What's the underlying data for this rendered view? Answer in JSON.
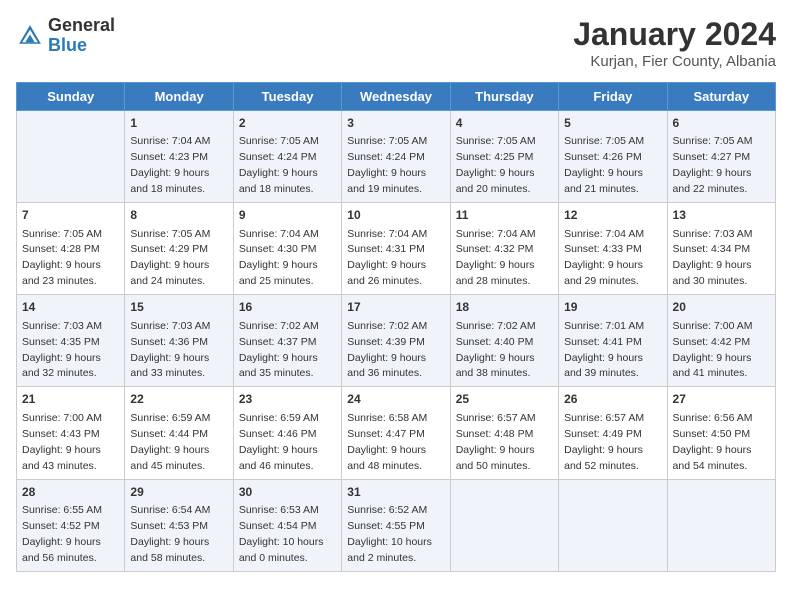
{
  "logo": {
    "general": "General",
    "blue": "Blue"
  },
  "calendar": {
    "title": "January 2024",
    "subtitle": "Kurjan, Fier County, Albania"
  },
  "headers": [
    "Sunday",
    "Monday",
    "Tuesday",
    "Wednesday",
    "Thursday",
    "Friday",
    "Saturday"
  ],
  "weeks": [
    [
      {
        "day": "",
        "sunrise": "",
        "sunset": "",
        "daylight": ""
      },
      {
        "day": "1",
        "sunrise": "7:04 AM",
        "sunset": "4:23 PM",
        "daylight": "9 hours and 18 minutes."
      },
      {
        "day": "2",
        "sunrise": "7:05 AM",
        "sunset": "4:24 PM",
        "daylight": "9 hours and 18 minutes."
      },
      {
        "day": "3",
        "sunrise": "7:05 AM",
        "sunset": "4:24 PM",
        "daylight": "9 hours and 19 minutes."
      },
      {
        "day": "4",
        "sunrise": "7:05 AM",
        "sunset": "4:25 PM",
        "daylight": "9 hours and 20 minutes."
      },
      {
        "day": "5",
        "sunrise": "7:05 AM",
        "sunset": "4:26 PM",
        "daylight": "9 hours and 21 minutes."
      },
      {
        "day": "6",
        "sunrise": "7:05 AM",
        "sunset": "4:27 PM",
        "daylight": "9 hours and 22 minutes."
      }
    ],
    [
      {
        "day": "7",
        "sunrise": "7:05 AM",
        "sunset": "4:28 PM",
        "daylight": "9 hours and 23 minutes."
      },
      {
        "day": "8",
        "sunrise": "7:05 AM",
        "sunset": "4:29 PM",
        "daylight": "9 hours and 24 minutes."
      },
      {
        "day": "9",
        "sunrise": "7:04 AM",
        "sunset": "4:30 PM",
        "daylight": "9 hours and 25 minutes."
      },
      {
        "day": "10",
        "sunrise": "7:04 AM",
        "sunset": "4:31 PM",
        "daylight": "9 hours and 26 minutes."
      },
      {
        "day": "11",
        "sunrise": "7:04 AM",
        "sunset": "4:32 PM",
        "daylight": "9 hours and 28 minutes."
      },
      {
        "day": "12",
        "sunrise": "7:04 AM",
        "sunset": "4:33 PM",
        "daylight": "9 hours and 29 minutes."
      },
      {
        "day": "13",
        "sunrise": "7:03 AM",
        "sunset": "4:34 PM",
        "daylight": "9 hours and 30 minutes."
      }
    ],
    [
      {
        "day": "14",
        "sunrise": "7:03 AM",
        "sunset": "4:35 PM",
        "daylight": "9 hours and 32 minutes."
      },
      {
        "day": "15",
        "sunrise": "7:03 AM",
        "sunset": "4:36 PM",
        "daylight": "9 hours and 33 minutes."
      },
      {
        "day": "16",
        "sunrise": "7:02 AM",
        "sunset": "4:37 PM",
        "daylight": "9 hours and 35 minutes."
      },
      {
        "day": "17",
        "sunrise": "7:02 AM",
        "sunset": "4:39 PM",
        "daylight": "9 hours and 36 minutes."
      },
      {
        "day": "18",
        "sunrise": "7:02 AM",
        "sunset": "4:40 PM",
        "daylight": "9 hours and 38 minutes."
      },
      {
        "day": "19",
        "sunrise": "7:01 AM",
        "sunset": "4:41 PM",
        "daylight": "9 hours and 39 minutes."
      },
      {
        "day": "20",
        "sunrise": "7:00 AM",
        "sunset": "4:42 PM",
        "daylight": "9 hours and 41 minutes."
      }
    ],
    [
      {
        "day": "21",
        "sunrise": "7:00 AM",
        "sunset": "4:43 PM",
        "daylight": "9 hours and 43 minutes."
      },
      {
        "day": "22",
        "sunrise": "6:59 AM",
        "sunset": "4:44 PM",
        "daylight": "9 hours and 45 minutes."
      },
      {
        "day": "23",
        "sunrise": "6:59 AM",
        "sunset": "4:46 PM",
        "daylight": "9 hours and 46 minutes."
      },
      {
        "day": "24",
        "sunrise": "6:58 AM",
        "sunset": "4:47 PM",
        "daylight": "9 hours and 48 minutes."
      },
      {
        "day": "25",
        "sunrise": "6:57 AM",
        "sunset": "4:48 PM",
        "daylight": "9 hours and 50 minutes."
      },
      {
        "day": "26",
        "sunrise": "6:57 AM",
        "sunset": "4:49 PM",
        "daylight": "9 hours and 52 minutes."
      },
      {
        "day": "27",
        "sunrise": "6:56 AM",
        "sunset": "4:50 PM",
        "daylight": "9 hours and 54 minutes."
      }
    ],
    [
      {
        "day": "28",
        "sunrise": "6:55 AM",
        "sunset": "4:52 PM",
        "daylight": "9 hours and 56 minutes."
      },
      {
        "day": "29",
        "sunrise": "6:54 AM",
        "sunset": "4:53 PM",
        "daylight": "9 hours and 58 minutes."
      },
      {
        "day": "30",
        "sunrise": "6:53 AM",
        "sunset": "4:54 PM",
        "daylight": "10 hours and 0 minutes."
      },
      {
        "day": "31",
        "sunrise": "6:52 AM",
        "sunset": "4:55 PM",
        "daylight": "10 hours and 2 minutes."
      },
      {
        "day": "",
        "sunrise": "",
        "sunset": "",
        "daylight": ""
      },
      {
        "day": "",
        "sunrise": "",
        "sunset": "",
        "daylight": ""
      },
      {
        "day": "",
        "sunrise": "",
        "sunset": "",
        "daylight": ""
      }
    ]
  ]
}
